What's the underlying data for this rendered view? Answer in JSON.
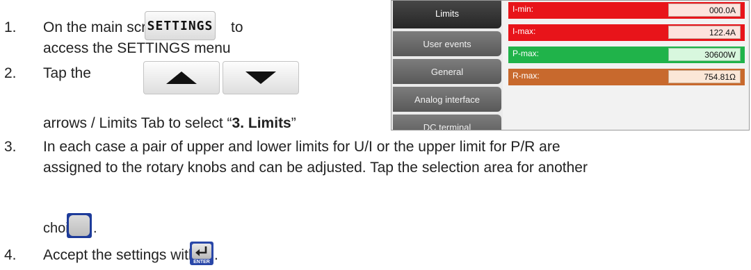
{
  "steps": {
    "s1": {
      "num": "1.",
      "pre": "On the main screen, tap",
      "post": "to",
      "line2": "access the SETTINGS menu",
      "button": "SETTINGS"
    },
    "s2": {
      "num": "2.",
      "pre": "Tap the",
      "line2a": "arrows / Limits Tab to select “",
      "line2b": "3. Limits",
      "line2c": "”"
    },
    "s3": {
      "num": "3.",
      "line1": "In each case a pair of upper and lower limits for U/I or the upper limit for P/R are",
      "line2": "assigned to the rotary knobs and can be adjusted. Tap the selection area for another",
      "line3": "choice",
      "line3end": "."
    },
    "s4": {
      "num": "4.",
      "text": "Accept the settings with",
      "end": ".",
      "key_label": "ENTER"
    }
  },
  "device": {
    "tabs": [
      "Limits",
      "User events",
      "General",
      "Analog interface",
      "DC terminal"
    ],
    "rows": [
      {
        "label": "I-min:",
        "value": "000.0A",
        "color": "#e8141a"
      },
      {
        "label": "I-max:",
        "value": "122.4A",
        "color": "#e8141a"
      },
      {
        "label": "P-max:",
        "value": "30600W",
        "color": "#20b34a"
      },
      {
        "label": "R-max:",
        "value": "754.81Ω",
        "color": "#c8692d"
      }
    ]
  }
}
